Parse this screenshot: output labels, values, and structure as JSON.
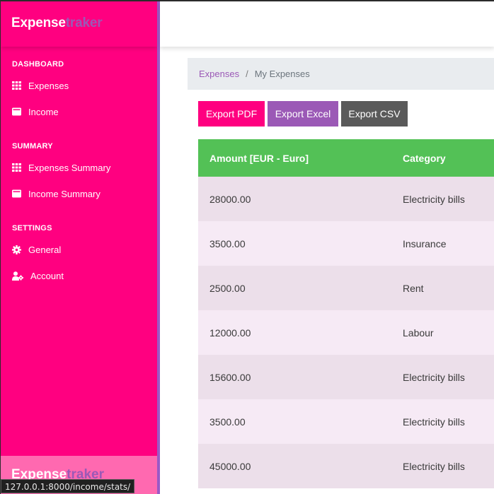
{
  "brand": {
    "primary": "Expense",
    "accent": "traker"
  },
  "sidebar": {
    "sections": [
      {
        "heading": "DASHBOARD",
        "items": [
          {
            "label": "Expenses",
            "icon": "grid-icon"
          },
          {
            "label": "Income",
            "icon": "wallet-icon"
          }
        ]
      },
      {
        "heading": "SUMMARY",
        "items": [
          {
            "label": "Expenses Summary",
            "icon": "grid-icon"
          },
          {
            "label": "Income Summary",
            "icon": "wallet-icon"
          }
        ]
      },
      {
        "heading": "SETTINGS",
        "items": [
          {
            "label": "General",
            "icon": "gear-icon"
          },
          {
            "label": "Account",
            "icon": "user-gear-icon"
          }
        ]
      }
    ]
  },
  "footer": {
    "primary": "Expense",
    "accent": "traker"
  },
  "status_url": "127.0.0.1:8000/income/stats/",
  "breadcrumb": {
    "link": "Expenses",
    "separator": "/",
    "current": "My Expenses"
  },
  "exports": {
    "pdf": "Export PDF",
    "excel": "Export Excel",
    "csv": "Export CSV"
  },
  "table": {
    "headers": {
      "amount": "Amount [EUR - Euro]",
      "category": "Category"
    },
    "rows": [
      {
        "amount": "28000.00",
        "category": "Electricity bills"
      },
      {
        "amount": "3500.00",
        "category": "Insurance"
      },
      {
        "amount": "2500.00",
        "category": "Rent"
      },
      {
        "amount": "12000.00",
        "category": "Labour"
      },
      {
        "amount": "15600.00",
        "category": "Electricity bills"
      },
      {
        "amount": "3500.00",
        "category": "Electricity bills"
      },
      {
        "amount": "45000.00",
        "category": "Electricity bills"
      }
    ]
  },
  "colors": {
    "sidebar": "#ff0080",
    "accent": "#9b59b6",
    "header_green": "#53c156",
    "export_pdf": "#ff0080",
    "export_excel": "#9b59b6",
    "export_csv": "#5a5a5a"
  }
}
